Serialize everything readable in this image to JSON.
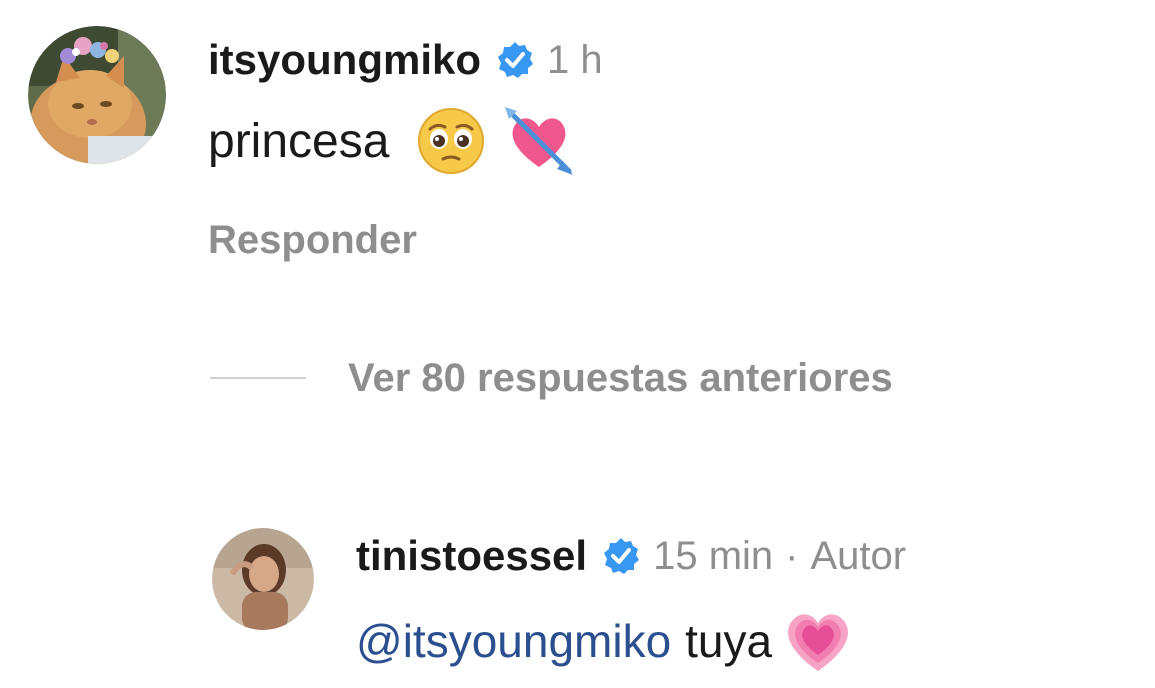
{
  "comment_1": {
    "username": "itsyoungmiko",
    "time": "1 h",
    "text": "princesa",
    "emojis": [
      "pleading-face-emoji",
      "heart-with-arrow-emoji"
    ],
    "reply_label": "Responder"
  },
  "view_replies": {
    "label": "Ver 80 respuestas anteriores"
  },
  "comment_2": {
    "username": "tinistoessel",
    "time": "15 min",
    "separator": "·",
    "author_label": "Autor",
    "mention": "@itsyoungmiko",
    "text": "tuya",
    "emojis": [
      "growing-heart-emoji"
    ]
  },
  "colors": {
    "verified": "#3897f0",
    "muted_text": "#8e8e8e",
    "mention": "#2b4f8f",
    "divider": "#d0d0d0"
  }
}
